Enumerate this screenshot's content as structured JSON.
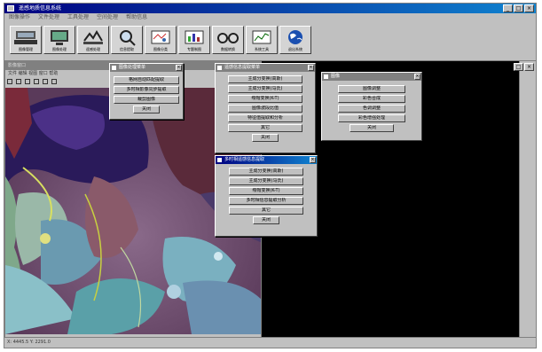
{
  "window": {
    "title": "遥感地质信息系统",
    "min": "_",
    "max": "□",
    "close": "×"
  },
  "menu": [
    "图像操作",
    "文件处理",
    "工具处理",
    "空间处理",
    "帮助信息"
  ],
  "toolbar": [
    {
      "label": "图像管理",
      "icon": "computer-icon"
    },
    {
      "label": "图像处理",
      "icon": "monitor-icon"
    },
    {
      "label": "遥感处理",
      "icon": "satellite-icon"
    },
    {
      "label": "信息提取",
      "icon": "magnifier-icon"
    },
    {
      "label": "图像分类",
      "icon": "map-icon"
    },
    {
      "label": "专题制图",
      "icon": "chart-icon"
    },
    {
      "label": "数据转换",
      "icon": "glasses-icon"
    },
    {
      "label": "系统工具",
      "icon": "graph-icon"
    },
    {
      "label": "退出系统",
      "icon": "globe-icon"
    }
  ],
  "image_window": {
    "title": "影像窗口",
    "menu": "文件 编辑 视图 窗口 帮助",
    "max": "□",
    "close": "×"
  },
  "dialogs": {
    "d1": {
      "title": "图像处理菜单",
      "items": [
        "格网自动匹配提取",
        "多时相影像同步提取",
        "裁剪图像"
      ],
      "close": "关闭"
    },
    "d2": {
      "title": "遥感信息提取菜单",
      "items": [
        "主成分变换(高斯)",
        "主成分变换(马氏)",
        "缨帽变换(K-T)",
        "图像波段比值",
        "特征值提取和分析"
      ],
      "other": "其它",
      "close": "关闭"
    },
    "d3": {
      "title": "图像",
      "items": [
        "图像调整",
        "彩色合成",
        "色调调整",
        "彩色增强处理"
      ],
      "close": "关闭"
    },
    "d4": {
      "title": "多时相遥感信息提取",
      "items": [
        "主成分变换(高斯)",
        "主成分变换(马氏)",
        "缨帽变换(K-T)",
        "多时相信息提取分析"
      ],
      "other": "其它",
      "close": "关闭"
    }
  },
  "statusbar": {
    "text": "X: 4445.5  Y: 2291.0"
  }
}
